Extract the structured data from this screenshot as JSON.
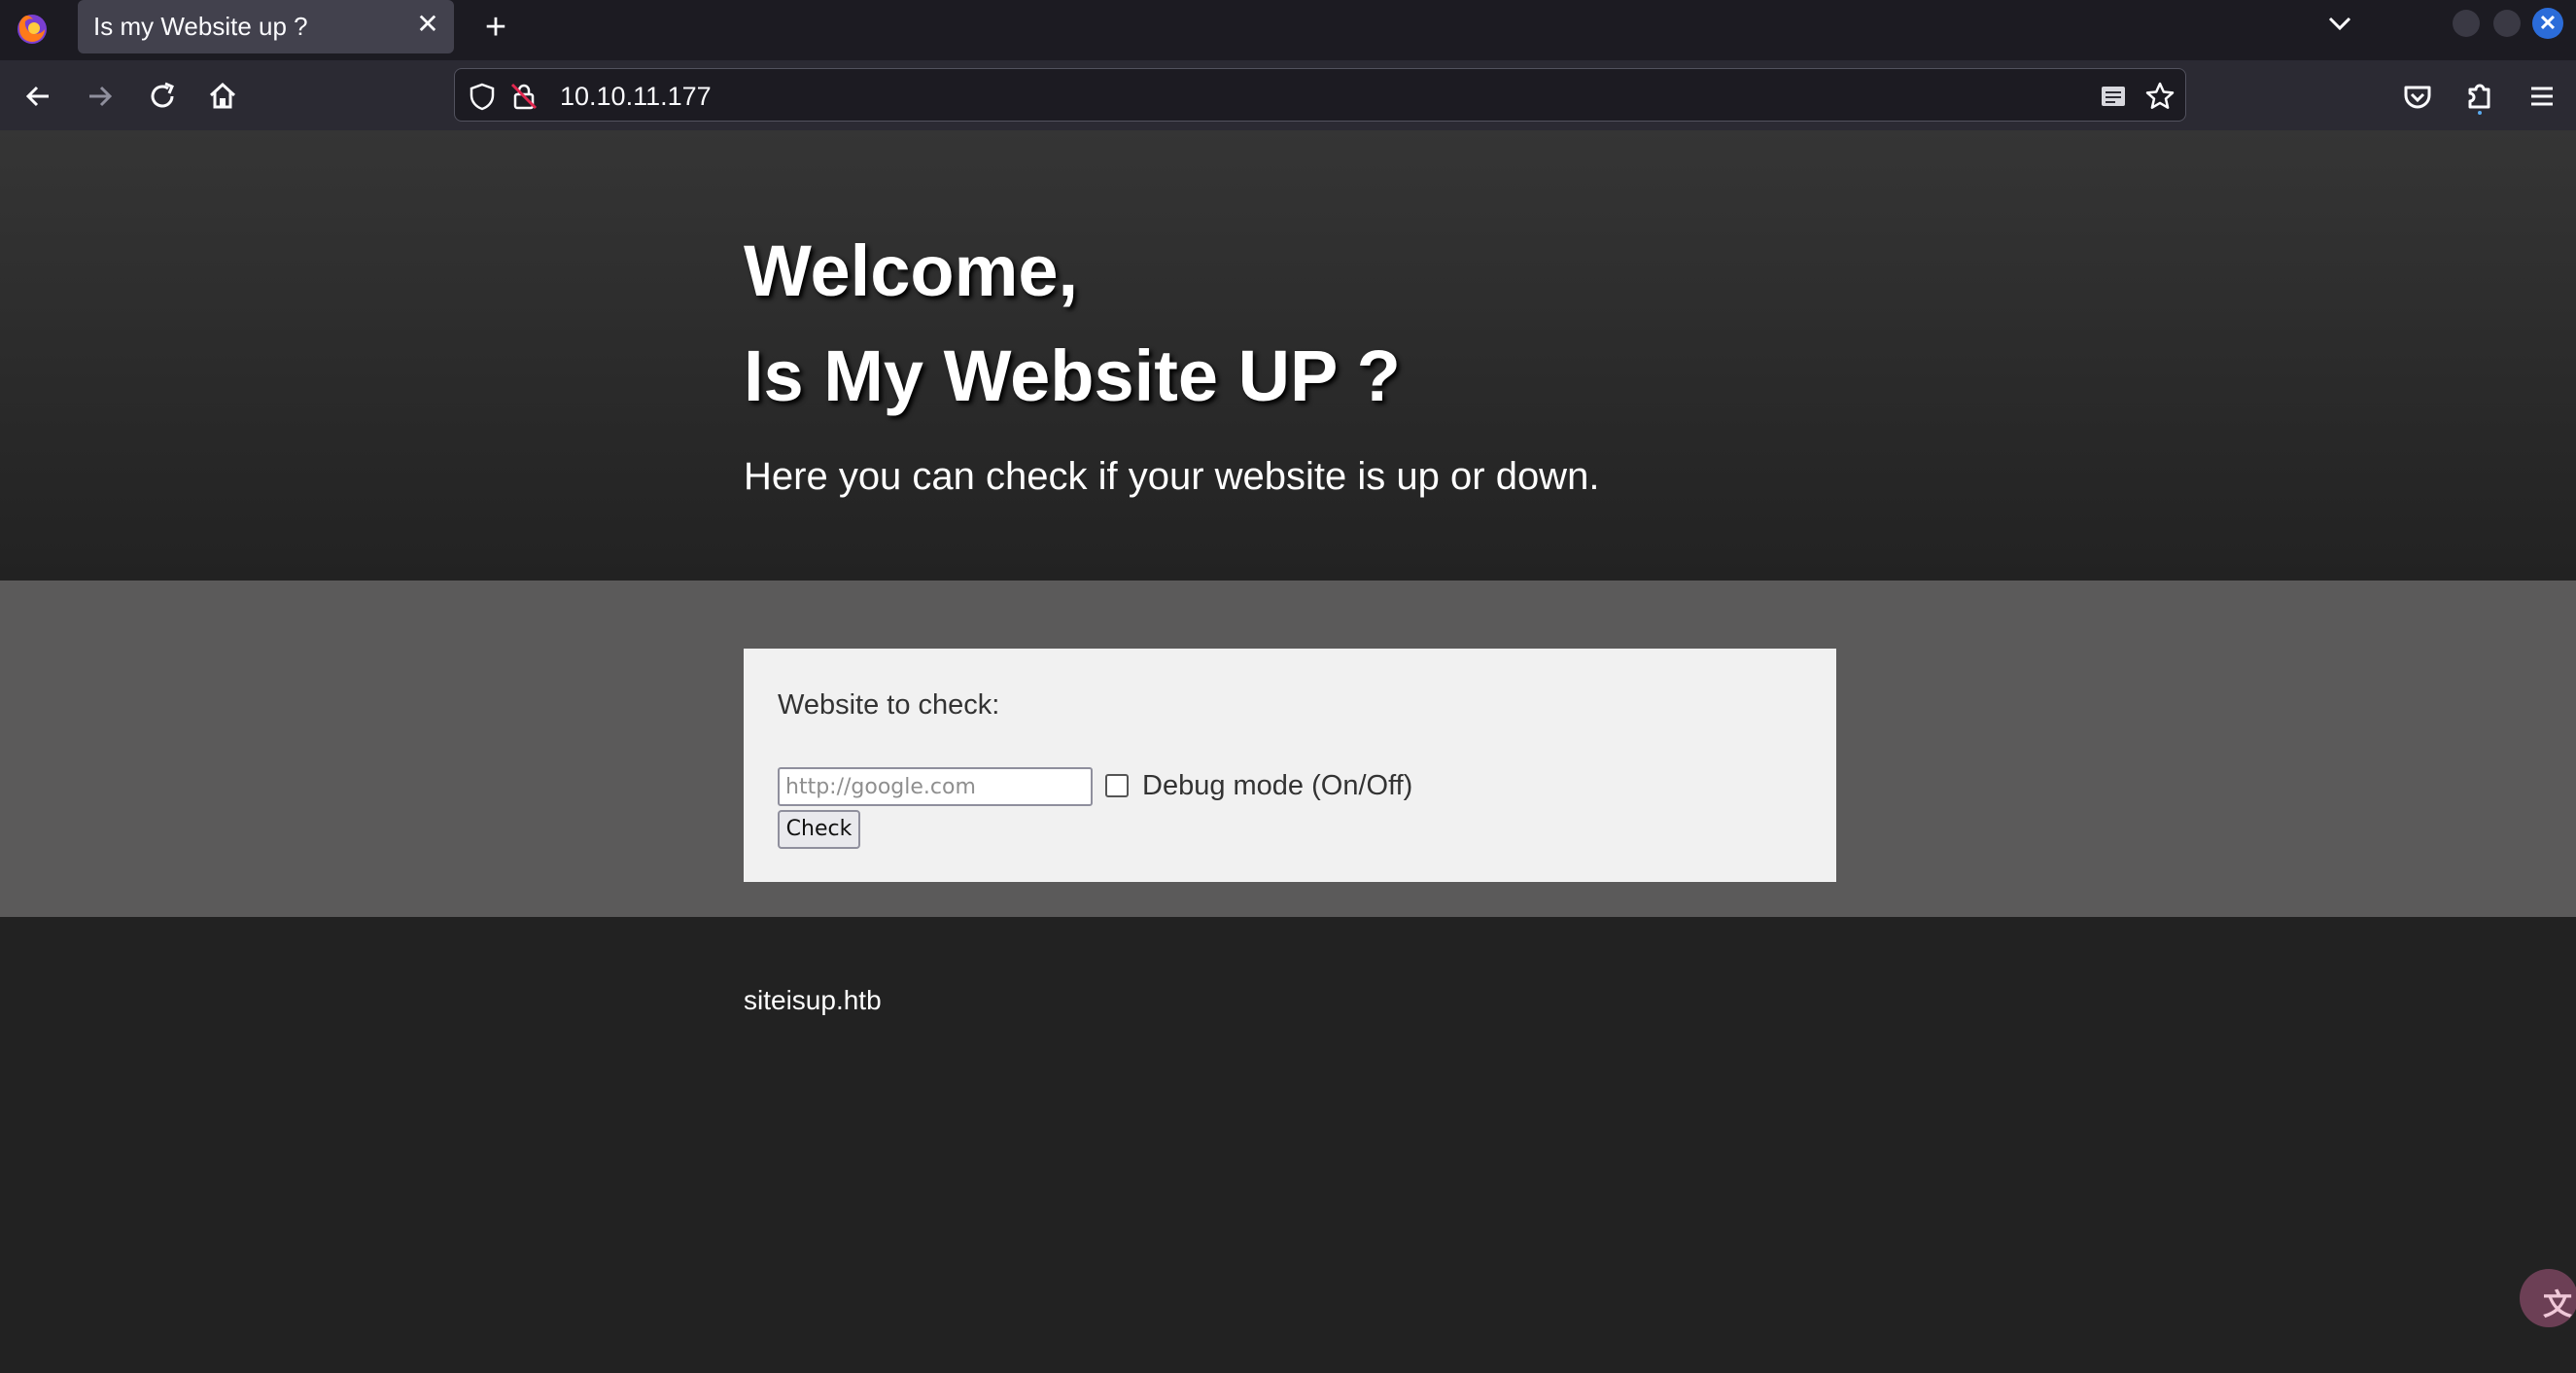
{
  "browser": {
    "tab_title": "Is my Website up ?",
    "tab_close": "✕",
    "new_tab": "+",
    "url": "10.10.11.177",
    "close_window": "✕",
    "icons": [
      "firefox-logo-icon",
      "back-arrow-icon",
      "forward-arrow-icon",
      "reload-icon",
      "home-icon",
      "shield-icon",
      "insecure-lock-icon",
      "reader-mode-icon",
      "bookmark-star-icon",
      "pocket-icon",
      "extensions-icon",
      "hamburger-menu-icon",
      "tab-list-chevron-icon",
      "translate-icon"
    ]
  },
  "page": {
    "heading1": "Welcome,",
    "heading2": "Is My Website UP ?",
    "lead": "Here you can check if your website is up or down.",
    "form": {
      "label": "Website to check:",
      "input_placeholder": "http://google.com",
      "input_value": "",
      "debug_label": "Debug mode (On/Off)",
      "debug_checked": false,
      "button": "Check"
    },
    "footer": "siteisup.htb"
  },
  "colors": {
    "hero_top": "#353535",
    "hero_bottom": "#222222",
    "form_band": "#5b5a5a",
    "card": "#f1f1f1",
    "footer": "#222222",
    "browser_chrome": "#2b2a33",
    "tab_strip": "#1c1b22"
  }
}
